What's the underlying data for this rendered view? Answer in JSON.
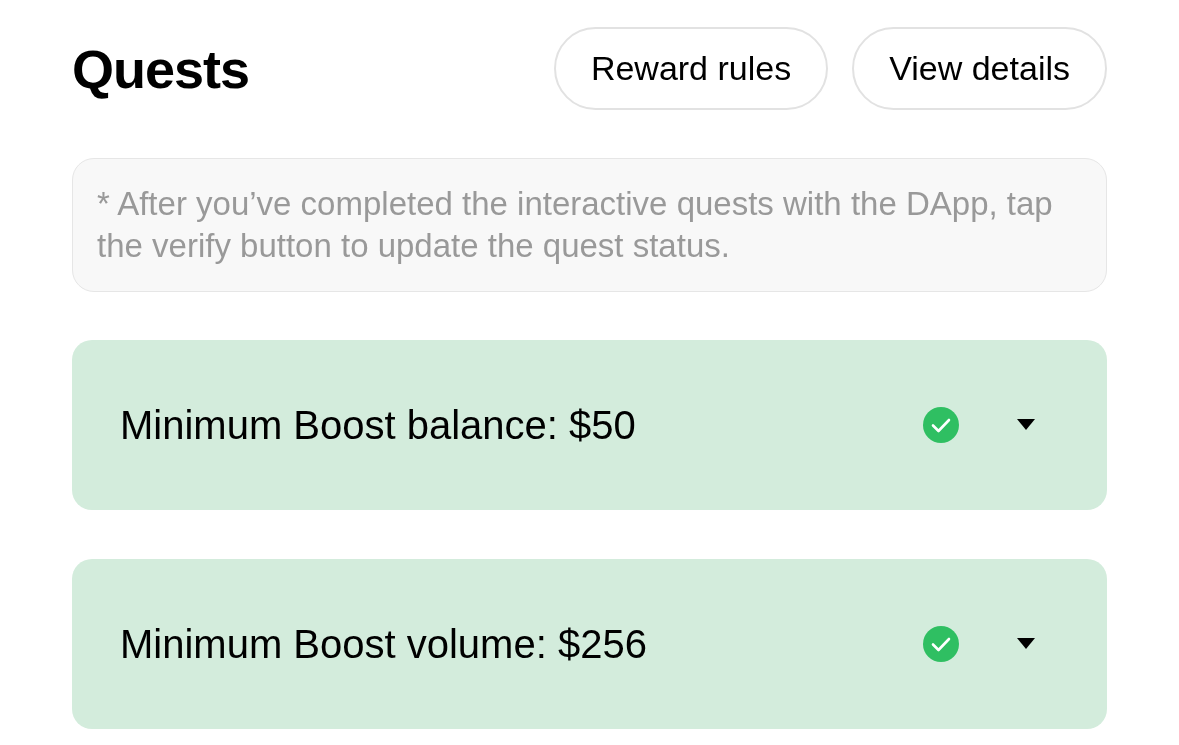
{
  "header": {
    "title": "Quests",
    "buttons": [
      "Reward rules",
      "View details"
    ]
  },
  "note": "* After you’ve completed the interactive quests with the DApp, tap the verify button to update the quest status.",
  "quests": [
    {
      "label": "Minimum Boost balance: $50",
      "completed": true,
      "expanded": false
    },
    {
      "label": "Minimum Boost volume: $256",
      "completed": true,
      "expanded": false
    }
  ]
}
